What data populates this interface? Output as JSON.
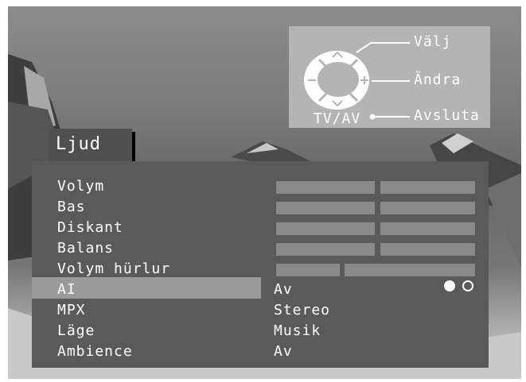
{
  "title": "Ljud",
  "hints": {
    "select": "Välj",
    "change": "Ändra",
    "exit": "Avsluta",
    "tvav": "TV/AV"
  },
  "menu": {
    "items": [
      {
        "label": "Volym",
        "bar_fill": 0.5
      },
      {
        "label": "Bas",
        "bar_fill": 0.5
      },
      {
        "label": "Diskant",
        "bar_fill": 0.5
      },
      {
        "label": "Balans",
        "bar_fill": 0.5
      },
      {
        "label": "Volym hürlur",
        "bar_fill": 0.33
      },
      {
        "label": "AI",
        "value": "Av",
        "selected": true
      },
      {
        "label": "MPX",
        "value": "Stereo"
      },
      {
        "label": "Läge",
        "value": "Musik"
      },
      {
        "label": "Ambience",
        "value": "Av"
      }
    ]
  },
  "ai_toggle": {
    "state": "on"
  }
}
